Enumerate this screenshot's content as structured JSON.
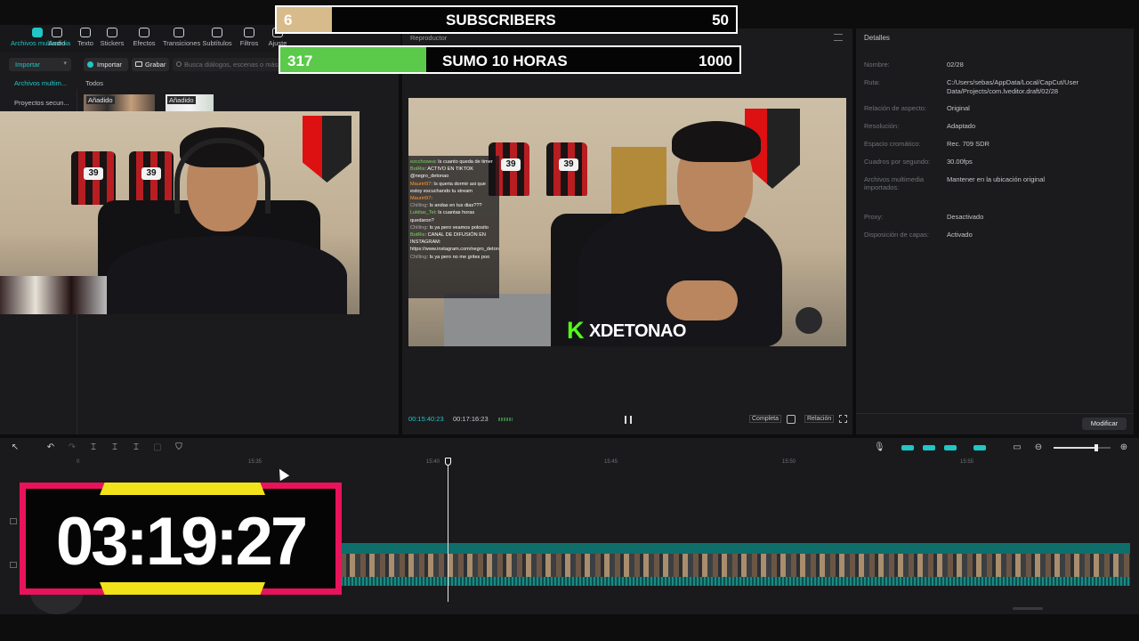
{
  "toolbar": {
    "items": [
      {
        "label": "Archivos multimedia",
        "icon": "media-icon"
      },
      {
        "label": "Audio",
        "icon": "audio-icon"
      },
      {
        "label": "Texto",
        "icon": "text-icon"
      },
      {
        "label": "Stickers",
        "icon": "sticker-icon"
      },
      {
        "label": "Efectos",
        "icon": "effects-icon"
      },
      {
        "label": "Transiciones",
        "icon": "transitions-icon"
      },
      {
        "label": "Subtítulos",
        "icon": "subtitles-icon"
      },
      {
        "label": "Filtros",
        "icon": "filters-icon"
      },
      {
        "label": "Ajuste",
        "icon": "adjust-icon"
      }
    ]
  },
  "media": {
    "import_label": "Importar",
    "import_btn": "Importar",
    "record_btn": "Grabar",
    "search_placeholder": "Busca diálogos, escenas o más",
    "sidebar": [
      "Archivos multim...",
      "Proyectos secun..."
    ],
    "filter_all": "Todos",
    "thumb_added_1": "Añadido",
    "thumb_added_2": "Añadido"
  },
  "player": {
    "title": "Reproductor",
    "current_time": "00:15:40:23",
    "total_time": "00:17:16:23",
    "full_label": "Completa",
    "ratio_label": "Relación",
    "name_tag": "XDETONAO",
    "name_tag_letter": "K",
    "chat": [
      {
        "user": "ezcchowea",
        "text": ": Is cuanto queda de timer",
        "cls": "u1"
      },
      {
        "user": "BotRix",
        "text": ": ACTIVO EN TIKTOK @negro_detonao",
        "cls": "u1"
      },
      {
        "user": "Mauriri97",
        "text": ": Is queria dormir asi que estoy escuchando tu stream",
        "cls": "u2"
      },
      {
        "user": "Mauriri97",
        "text": ":",
        "cls": "u2"
      },
      {
        "user": "Chilling",
        "text": ": Is andas en tus dias???",
        "cls": "u3"
      },
      {
        "user": "Lukitas_Tei",
        "text": ": Is cuantas horas quedaron?",
        "cls": "u1"
      },
      {
        "user": "Chilling",
        "text": ": Is ya pero veamos polosito",
        "cls": "u3"
      },
      {
        "user": "BotRix",
        "text": ": CANAL DE DIFUSIÓN EN INSTAGRAM: https://www.instagram.com/negro_detonao",
        "cls": "u1"
      },
      {
        "user": "Chilling",
        "text": ": Is ya pero no me grites poo",
        "cls": "u3"
      }
    ]
  },
  "details": {
    "title": "Detalles",
    "rows": [
      {
        "label": "Nombre:",
        "value": "02/28"
      },
      {
        "label": "Ruta:",
        "value": "C:/Users/sebas/AppData/Local/CapCut/User Data/Projects/com.lveditor.draft/02/28"
      },
      {
        "label": "Relación de aspecto:",
        "value": "Original"
      },
      {
        "label": "Resolución:",
        "value": "Adaptado"
      },
      {
        "label": "Espacio cromático:",
        "value": "Rec. 709 SDR"
      },
      {
        "label": "Cuadros por segundo:",
        "value": "30.00fps"
      },
      {
        "label": "Archivos multimedia importados:",
        "value": "Mantener en la ubicación original"
      },
      {
        "label": "Proxy:",
        "value": "Desactivado"
      },
      {
        "label": "Disposición de capas:",
        "value": "Activado"
      }
    ],
    "modify_btn": "Modificar"
  },
  "overlays": {
    "subs_count": "6",
    "subs_label": "SUBSCRIBERS",
    "subs_goal": "50",
    "subs_progress": 0.12,
    "hours_count": "317",
    "hours_label": "SUMO 10 HORAS",
    "hours_goal": "1000",
    "hours_progress": 0.317,
    "timer": "03:19:27"
  },
  "timeline": {
    "ticks": [
      "0",
      "15:35",
      "15:40",
      "15:45",
      "15:50",
      "15:55"
    ]
  },
  "colors": {
    "accent": "#21c6c6",
    "timer_border": "#e8135b",
    "timer_yellow": "#f2e21a",
    "hours_fill": "#5bc94a",
    "subs_fill": "#d8bb8a",
    "track_teal": "#0f6e6a"
  }
}
